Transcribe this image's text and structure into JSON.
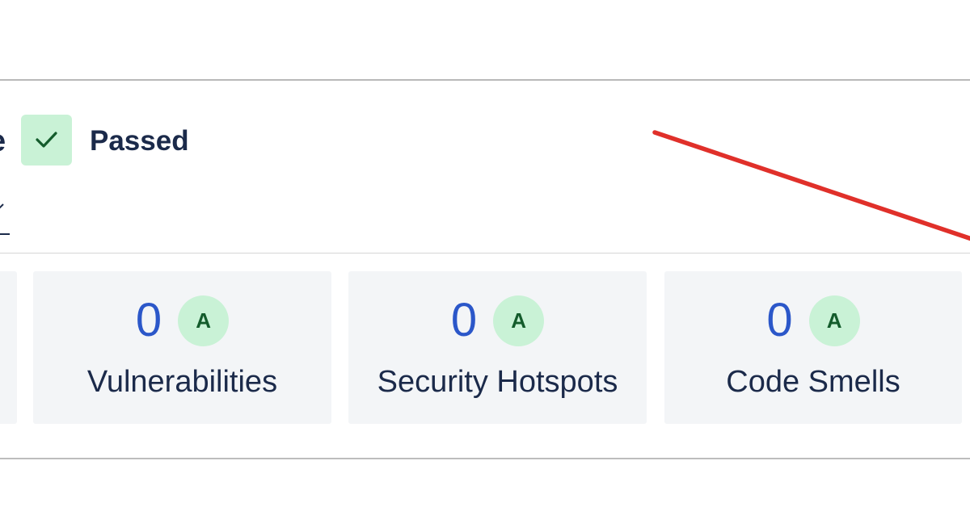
{
  "quality_gate": {
    "title_fragment": "e",
    "status": "Passed",
    "status_icon": "check-icon",
    "status_color": "#c9f2d6",
    "check_color": "#145c2c"
  },
  "metrics": [
    {
      "key": "vulnerabilities",
      "value": "0",
      "rating": "A",
      "label": "Vulnerabilities"
    },
    {
      "key": "security_hotspots",
      "value": "0",
      "rating": "A",
      "label": "Security Hotspots"
    },
    {
      "key": "code_smells",
      "value": "0",
      "rating": "A",
      "label": "Code Smells"
    }
  ],
  "colors": {
    "metric_value": "#2b57c9",
    "rating_bg": "#c9f2d6",
    "rating_text": "#145c2c",
    "card_bg": "#f3f5f7",
    "annotation_arrow": "#e0302a",
    "text": "#1b2a4a"
  }
}
